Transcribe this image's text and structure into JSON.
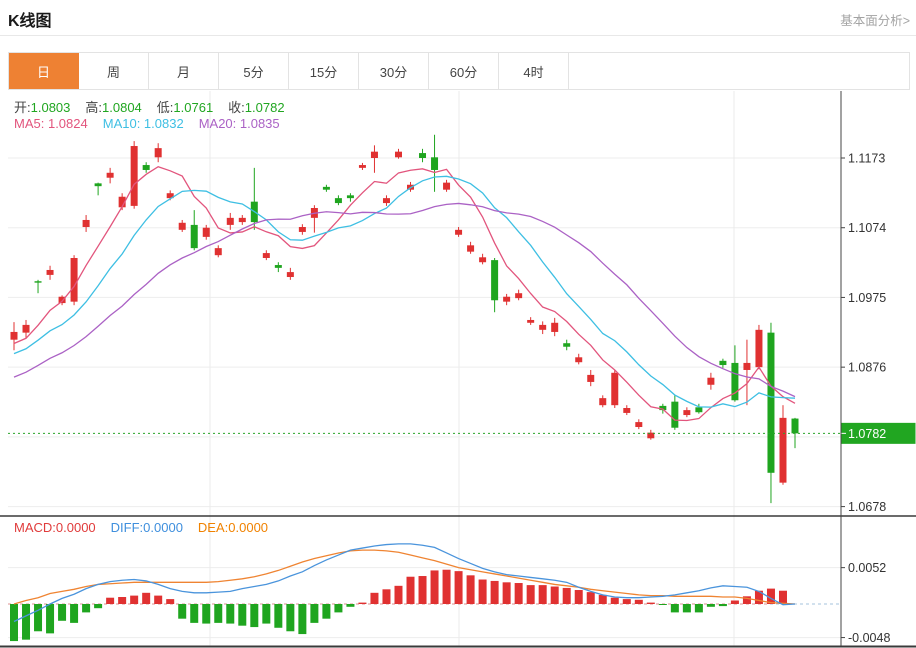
{
  "header": {
    "title": "K线图",
    "link": "基本面分析>"
  },
  "tabs": {
    "items": [
      "日",
      "周",
      "月",
      "5分",
      "15分",
      "30分",
      "60分",
      "4时"
    ],
    "active_index": 0
  },
  "legend": {
    "ohlc": [
      {
        "label": "开:",
        "value": "1.0803"
      },
      {
        "label": "高:",
        "value": "1.0804"
      },
      {
        "label": "低:",
        "value": "1.0761"
      },
      {
        "label": "收:",
        "value": "1.0782"
      }
    ],
    "ma": [
      {
        "label": "MA5: ",
        "value": "1.0824"
      },
      {
        "label": "MA10: ",
        "value": "1.0832"
      },
      {
        "label": "MA20: ",
        "value": "1.0835"
      }
    ],
    "macd": [
      {
        "label": "MACD:",
        "value": "0.0000"
      },
      {
        "label": "DIFF:",
        "value": "0.0000"
      },
      {
        "label": "DEA:",
        "value": "0.0000"
      }
    ]
  },
  "price_axis": {
    "ticks": [
      {
        "price": 1.1173,
        "label": "1.1173"
      },
      {
        "price": 1.1074,
        "label": "1.1074"
      },
      {
        "price": 1.0975,
        "label": "1.0975"
      },
      {
        "price": 1.0876,
        "label": "1.0876"
      },
      {
        "price": 1.0777,
        "label": ""
      },
      {
        "price": 1.0678,
        "label": "1.0678"
      }
    ],
    "current": {
      "price": 1.0782,
      "label": "1.0782"
    }
  },
  "macd_axis": {
    "ticks": [
      {
        "value": 0.0052,
        "label": "0.0052"
      },
      {
        "value": -0.0048,
        "label": "-0.0048"
      }
    ]
  },
  "colors": {
    "up": "#e03131",
    "down": "#1fa51f",
    "ma5": "#e2557d",
    "ma10": "#3ebfe3",
    "ma20": "#ab62c5",
    "diff": "#4a94dc",
    "dea": "#ef8432",
    "badge": "#21a621",
    "current_line": "#2aa52a",
    "tab_active": "#ee8133"
  },
  "chart_data": {
    "type": "candlestick+macd",
    "title": "K线图",
    "ylim_main": [
      1.0678,
      1.1173
    ],
    "ylim_macd": [
      -0.0048,
      0.0052
    ],
    "candles": [
      [
        1.0915,
        1.094,
        1.09,
        1.0926
      ],
      [
        1.0925,
        1.0943,
        1.0917,
        1.0936
      ],
      [
        1.0998,
        1.1,
        1.0981,
        1.0996
      ],
      [
        1.1007,
        1.102,
        1.1,
        1.1014
      ],
      [
        1.0967,
        1.0978,
        1.0964,
        1.0976
      ],
      [
        1.0969,
        1.1035,
        1.0964,
        1.1031
      ],
      [
        1.1075,
        1.1092,
        1.1068,
        1.1085
      ],
      [
        1.1137,
        1.1138,
        1.112,
        1.1133
      ],
      [
        1.1145,
        1.1159,
        1.1137,
        1.1152
      ],
      [
        1.1103,
        1.1123,
        1.1099,
        1.1118
      ],
      [
        1.1105,
        1.1197,
        1.1101,
        1.119
      ],
      [
        1.1163,
        1.1167,
        1.1152,
        1.1156
      ],
      [
        1.1174,
        1.1194,
        1.1167,
        1.1187
      ],
      [
        1.1116,
        1.1127,
        1.1113,
        1.1123
      ],
      [
        1.1071,
        1.1085,
        1.1068,
        1.1081
      ],
      [
        1.1078,
        1.1099,
        1.1042,
        1.1045
      ],
      [
        1.1061,
        1.1078,
        1.1057,
        1.1074
      ],
      [
        1.1035,
        1.1049,
        1.1032,
        1.1045
      ],
      [
        1.1078,
        1.1095,
        1.1071,
        1.1088
      ],
      [
        1.1082,
        1.1092,
        1.1078,
        1.1088
      ],
      [
        1.1111,
        1.1159,
        1.1071,
        1.1082
      ],
      [
        1.1031,
        1.1042,
        1.1028,
        1.1038
      ],
      [
        1.1021,
        1.1025,
        1.1011,
        1.1017
      ],
      [
        1.1004,
        1.1017,
        1.1,
        1.1011
      ],
      [
        1.1068,
        1.1079,
        1.1064,
        1.1075
      ],
      [
        1.1088,
        1.1106,
        1.1067,
        1.1102
      ],
      [
        1.1132,
        1.1135,
        1.1125,
        1.1128
      ],
      [
        1.1116,
        1.112,
        1.1106,
        1.1109
      ],
      [
        1.112,
        1.1123,
        1.1111,
        1.1116
      ],
      [
        1.1159,
        1.1166,
        1.1156,
        1.1163
      ],
      [
        1.1173,
        1.1191,
        1.1152,
        1.1182
      ],
      [
        1.1109,
        1.112,
        1.1105,
        1.1116
      ],
      [
        1.1174,
        1.1186,
        1.1172,
        1.1182
      ],
      [
        1.1128,
        1.1139,
        1.1125,
        1.1135
      ],
      [
        1.118,
        1.1186,
        1.1167,
        1.1173
      ],
      [
        1.1174,
        1.1206,
        1.1125,
        1.1156
      ],
      [
        1.1128,
        1.1142,
        1.1125,
        1.1138
      ],
      [
        1.1064,
        1.1075,
        1.1061,
        1.1071
      ],
      [
        1.104,
        1.1054,
        1.1037,
        1.1049
      ],
      [
        1.1025,
        1.1037,
        1.1022,
        1.1032
      ],
      [
        1.1028,
        1.1031,
        1.0954,
        1.0971
      ],
      [
        1.0969,
        1.098,
        1.0964,
        1.0976
      ],
      [
        1.0974,
        1.0986,
        1.0971,
        1.0981
      ],
      [
        1.0939,
        1.0947,
        1.0936,
        1.0943
      ],
      [
        1.0929,
        1.0941,
        1.0923,
        1.0936
      ],
      [
        1.0926,
        1.0946,
        1.092,
        1.0939
      ],
      [
        1.091,
        1.0915,
        1.09,
        1.0905
      ],
      [
        1.0883,
        1.0895,
        1.088,
        1.089
      ],
      [
        1.0855,
        1.0872,
        1.0849,
        1.0865
      ],
      [
        1.0822,
        1.0836,
        1.0819,
        1.0832
      ],
      [
        1.0822,
        1.0872,
        1.0818,
        1.0868
      ],
      [
        1.0811,
        1.0822,
        1.0808,
        1.0818
      ],
      [
        1.0791,
        1.0802,
        1.0788,
        1.0798
      ],
      [
        1.0775,
        1.0787,
        1.0773,
        1.0783
      ],
      [
        1.0821,
        1.0824,
        1.081,
        1.0815
      ],
      [
        1.0827,
        1.0836,
        1.0787,
        1.079
      ],
      [
        1.0808,
        1.0819,
        1.0805,
        1.0815
      ],
      [
        1.0819,
        1.0824,
        1.081,
        1.0812
      ],
      [
        1.0851,
        1.0868,
        1.0844,
        1.0861
      ],
      [
        1.0885,
        1.0888,
        1.0875,
        1.0879
      ],
      [
        1.0882,
        1.0907,
        1.0827,
        1.0829
      ],
      [
        1.0872,
        1.0915,
        1.0822,
        1.0882
      ],
      [
        1.0876,
        1.0936,
        1.0873,
        1.0929
      ],
      [
        1.0925,
        1.0939,
        1.0683,
        1.0726
      ],
      [
        1.0712,
        1.0822,
        1.0709,
        1.0804
      ],
      [
        1.0803,
        1.0804,
        1.0761,
        1.0782
      ]
    ],
    "ma_lines": [
      {
        "name": "MA5",
        "period": 5,
        "color": "#e2557d"
      },
      {
        "name": "MA10",
        "period": 10,
        "color": "#3ebfe3"
      },
      {
        "name": "MA20",
        "period": 20,
        "color": "#ab62c5"
      }
    ],
    "ma_seed_closes": [
      1.079,
      1.0797,
      1.0804,
      1.0811,
      1.0818,
      1.0825,
      1.0832,
      1.0839,
      1.0846,
      1.0853,
      1.086,
      1.0867,
      1.0874,
      1.0881,
      1.0888,
      1.0894,
      1.0899,
      1.0904,
      1.0908,
      1.0911
    ],
    "macd_histogram": [
      -0.0053,
      -0.0051,
      -0.0039,
      -0.0042,
      -0.0024,
      -0.0027,
      -0.0012,
      -0.0006,
      0.0009,
      0.001,
      0.0012,
      0.0016,
      0.0012,
      0.0007,
      -0.0021,
      -0.0027,
      -0.0028,
      -0.0027,
      -0.0028,
      -0.0031,
      -0.0033,
      -0.0028,
      -0.0034,
      -0.0039,
      -0.0043,
      -0.0027,
      -0.0021,
      -0.0012,
      -0.0004,
      0.0002,
      0.0016,
      0.0021,
      0.0026,
      0.0039,
      0.004,
      0.0048,
      0.0049,
      0.0047,
      0.0041,
      0.0035,
      0.0033,
      0.0031,
      0.003,
      0.0027,
      0.0027,
      0.0025,
      0.0023,
      0.002,
      0.0017,
      0.0013,
      0.0009,
      0.0007,
      0.0006,
      0.0002,
      -0.0001,
      -0.0012,
      -0.0012,
      -0.0012,
      -0.0004,
      -0.0003,
      0.0005,
      0.0011,
      0.0019,
      0.0022,
      0.0019,
      0.0
    ],
    "diff": [
      -0.0025,
      -0.0017,
      -0.0009,
      0.0,
      0.0008,
      0.0014,
      0.0022,
      0.0028,
      0.0032,
      0.0034,
      0.0035,
      0.0033,
      0.0028,
      0.0022,
      0.0018,
      0.0016,
      0.0016,
      0.0017,
      0.0018,
      0.0022,
      0.0025,
      0.0028,
      0.0033,
      0.004,
      0.0046,
      0.0055,
      0.0063,
      0.007,
      0.0077,
      0.008,
      0.0083,
      0.0085,
      0.0086,
      0.0086,
      0.0084,
      0.0081,
      0.0073,
      0.0065,
      0.0058,
      0.0051,
      0.0046,
      0.0042,
      0.004,
      0.0038,
      0.0036,
      0.0034,
      0.0031,
      0.0024,
      0.0018,
      0.0013,
      0.001,
      0.0009,
      0.0009,
      0.001,
      0.0011,
      0.0013,
      0.0016,
      0.0019,
      0.0023,
      0.0026,
      0.0025,
      0.0024,
      0.0018,
      0.0008,
      -0.0001,
      0.0
    ],
    "dea": [
      0.0,
      0.0005,
      0.0009,
      0.0015,
      0.0018,
      0.0021,
      0.0025,
      0.0028,
      0.0029,
      0.003,
      0.0031,
      0.0031,
      0.0031,
      0.0031,
      0.0031,
      0.0031,
      0.0031,
      0.0032,
      0.0034,
      0.0036,
      0.0039,
      0.0043,
      0.0048,
      0.0054,
      0.006,
      0.0065,
      0.0069,
      0.0073,
      0.0076,
      0.0077,
      0.0077,
      0.0076,
      0.0074,
      0.007,
      0.0066,
      0.0062,
      0.0057,
      0.0052,
      0.0049,
      0.0046,
      0.0043,
      0.004,
      0.0037,
      0.0034,
      0.0031,
      0.0028,
      0.0026,
      0.0024,
      0.0021,
      0.0019,
      0.0017,
      0.0015,
      0.0013,
      0.0012,
      0.0012,
      0.0011,
      0.0011,
      0.0011,
      0.0011,
      0.001,
      0.001,
      0.0008,
      0.0005,
      0.0002,
      0.0001,
      0.0
    ]
  }
}
